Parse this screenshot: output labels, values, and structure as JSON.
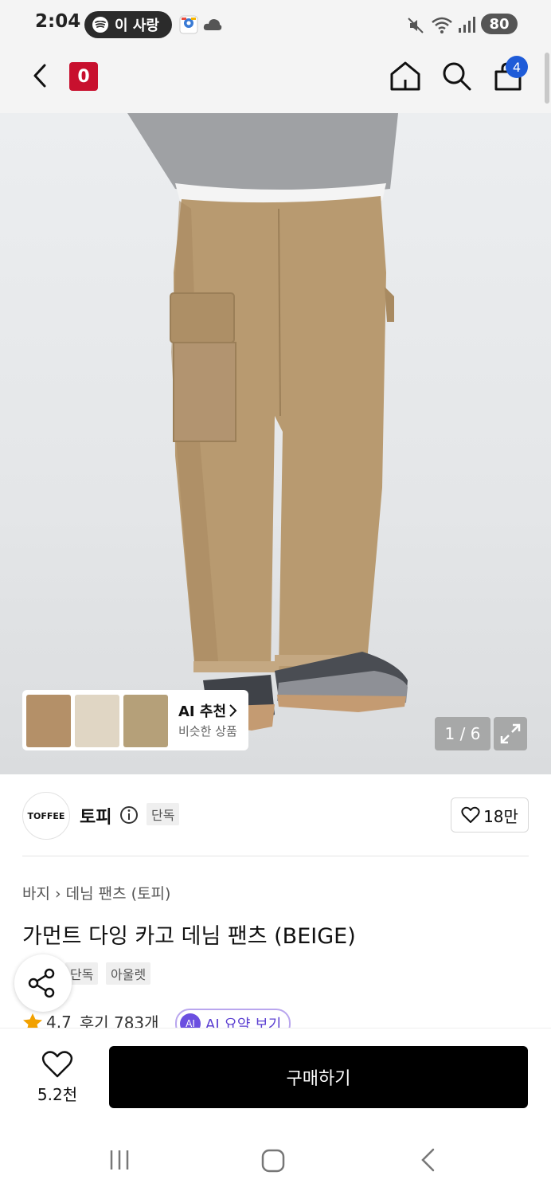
{
  "status_bar": {
    "time": "2:04",
    "now_playing": "이 사랑",
    "battery": "80"
  },
  "app_bar": {
    "logo_letter": "0",
    "cart_count": "4"
  },
  "gallery": {
    "ai_recommend_title": "AI 추천",
    "ai_recommend_sub": "비슷한 상품",
    "counter": "1 / 6"
  },
  "brand": {
    "logo_text": "TOFFEE",
    "name": "토피",
    "exclusive_tag": "단독",
    "like_count": "18만"
  },
  "product": {
    "breadcrumb_1": "바지",
    "breadcrumb_2": "데님 팬츠 (토피)",
    "title": "가먼트 다잉 카고 데님 팬츠 (BEIGE)",
    "tag_exclusive": "단독",
    "tag_outlet": "아울렛",
    "rating": "4.7",
    "reviews": "후기 783개",
    "ai_summary": "AI 요약 보기"
  },
  "bottom": {
    "wish_count": "5.2천",
    "buy_label": "구매하기"
  },
  "colors": {
    "brand_red": "#c8102e",
    "badge_blue": "#1e5bd8",
    "pants_beige": "#b89a70",
    "star": "#f2a100"
  }
}
